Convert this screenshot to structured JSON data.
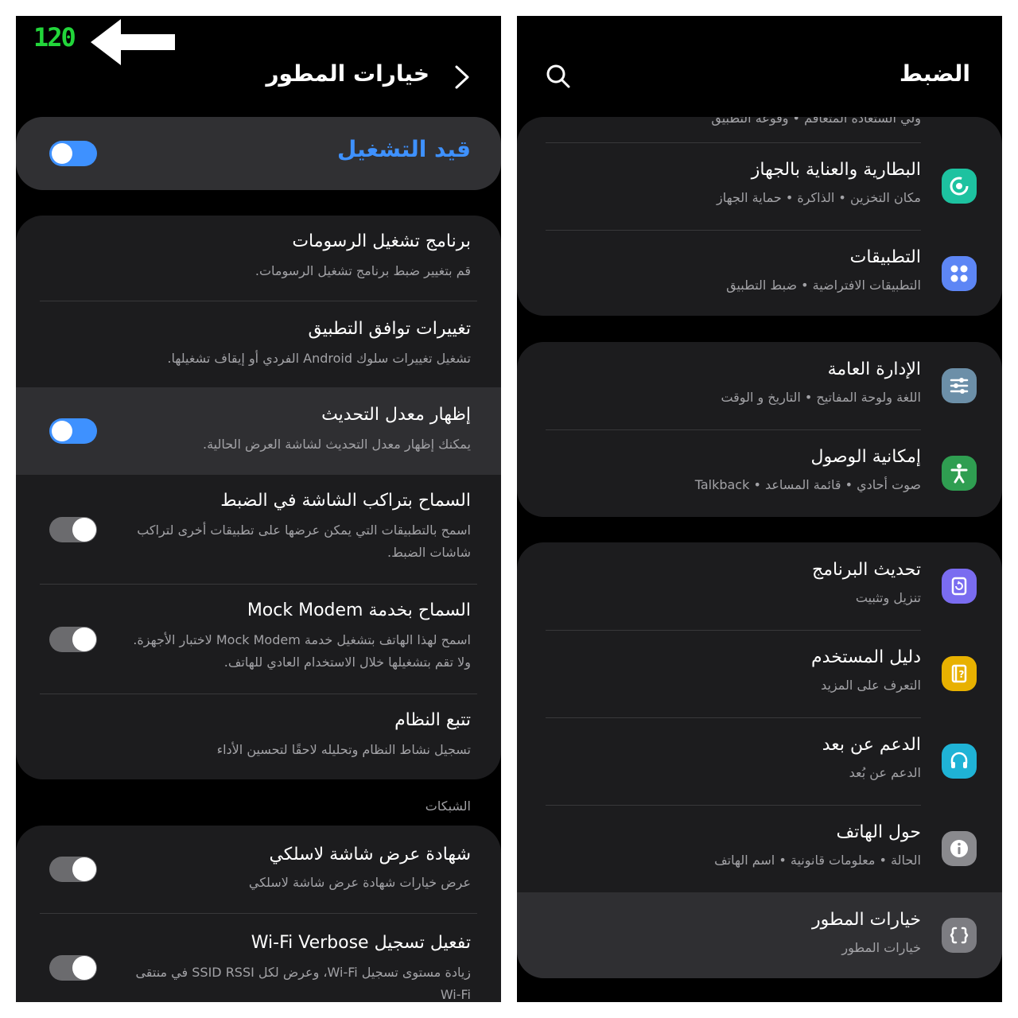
{
  "left": {
    "fps_counter": "120",
    "title": "خيارات المطور",
    "master_toggle": {
      "label": "قيد التشغيل",
      "on": true
    },
    "items": [
      {
        "title": "برنامج تشغيل الرسومات",
        "subtitle": "قم بتغيير ضبط برنامج تشغيل الرسومات."
      },
      {
        "title": "تغييرات توافق التطبيق",
        "subtitle": "تشغيل تغييرات سلوك Android الفردي أو إيقاف تشغيلها."
      },
      {
        "title": "إظهار معدل التحديث",
        "subtitle": "يمكنك إظهار معدل التحديث لشاشة العرض الحالية."
      },
      {
        "title": "السماح بتراكب الشاشة في الضبط",
        "subtitle": "اسمح بالتطبيقات التي يمكن عرضها على تطبيقات أخرى لتراكب شاشات الضبط."
      },
      {
        "title": "السماح بخدمة Mock Modem",
        "subtitle": "اسمح لهذا الهاتف بتشغيل خدمة Mock Modem لاختبار الأجهزة. ولا تقم بتشغيلها خلال الاستخدام العادي للهاتف."
      },
      {
        "title": "تتبع النظام",
        "subtitle": "تسجيل نشاط النظام وتحليله لاحقًا لتحسين الأداء"
      }
    ],
    "section_networks": "الشبكات",
    "network_items": [
      {
        "title": "شهادة عرض شاشة لاسلكي",
        "subtitle": "عرض خيارات شهادة عرض شاشة لاسلكي"
      },
      {
        "title": "تفعيل تسجيل Wi-Fi Verbose",
        "subtitle": "زيادة مستوى تسجيل Wi-Fi، وعرض لكل SSID RSSI في منتقى Wi-Fi"
      }
    ]
  },
  "right": {
    "title": "الضبط",
    "cut_off_text": "ولي الستعادة المتعاقم • وقوعة التطبيق",
    "group1": [
      {
        "title": "البطارية والعناية بالجهاز",
        "subtitle": "مكان التخزين • الذاكرة • حماية الجهاز",
        "icon": "device-care-icon",
        "color": "#1dc2a0"
      },
      {
        "title": "التطبيقات",
        "subtitle": "التطبيقات الافتراضية • ضبط التطبيق",
        "icon": "apps-icon",
        "color": "#5d86f5"
      }
    ],
    "group2": [
      {
        "title": "الإدارة العامة",
        "subtitle": "اللغة ولوحة المفاتيح • التاريخ و الوقت",
        "icon": "general-management-icon",
        "color": "#6c8fa8"
      },
      {
        "title": "إمكانية الوصول",
        "subtitle": "صوت أحادي • قائمة المساعد • Talkback",
        "icon": "accessibility-icon",
        "color": "#2f9e51"
      }
    ],
    "group3": [
      {
        "title": "تحديث البرنامج",
        "subtitle": "تنزيل وتثبيت",
        "icon": "software-update-icon",
        "color": "#7a6cf0"
      },
      {
        "title": "دليل المستخدم",
        "subtitle": "التعرف على المزيد",
        "icon": "user-manual-icon",
        "color": "#e8b100"
      },
      {
        "title": "الدعم عن بعد",
        "subtitle": "الدعم عن بُعد",
        "icon": "remote-support-icon",
        "color": "#1fb3d6"
      },
      {
        "title": "حول الهاتف",
        "subtitle": "الحالة • معلومات قانونية • اسم الهاتف",
        "icon": "about-phone-icon",
        "color": "#8a8a8e"
      },
      {
        "title": "خيارات المطور",
        "subtitle": "خيارات المطور",
        "icon": "developer-options-icon",
        "color": "#7d7d82"
      }
    ]
  },
  "colors": {
    "accent_blue": "#3e91ff",
    "fps_green": "#22d63a",
    "title_blue": "#3e91ff"
  }
}
